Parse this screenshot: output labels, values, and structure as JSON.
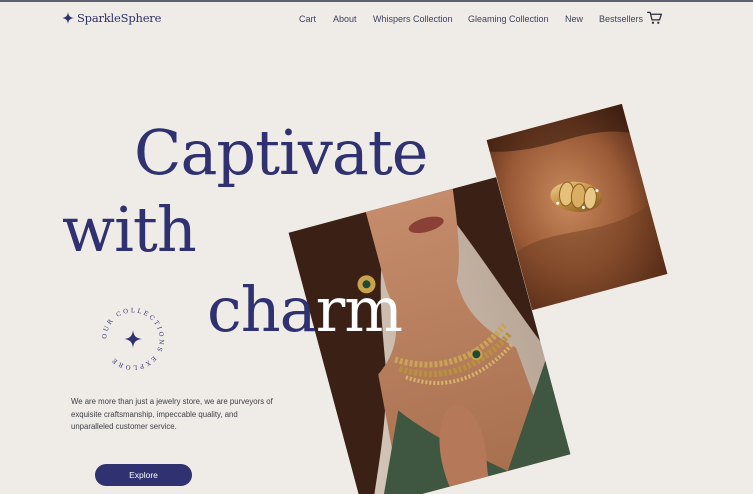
{
  "header": {
    "logo_text": "SparkleSphere",
    "nav": [
      {
        "label": "Cart"
      },
      {
        "label": "About"
      },
      {
        "label": "Whispers Collection"
      },
      {
        "label": "Gleaming Collection"
      },
      {
        "label": "New"
      },
      {
        "label": "Bestsellers"
      }
    ],
    "cart_icon": "shopping-cart-icon"
  },
  "hero": {
    "line1": "Captivate",
    "line2": "with",
    "line3_dark": "cha",
    "line3_light": "rm",
    "badge_text": "OUR COLLECTIONS EXPLORE",
    "badge_icon": "four-point-star-icon",
    "tagline": "We are more than just a jewelry store, we are purveyors of exquisite craftsmanship, impeccable quality, and unparalleled customer service.",
    "cta_label": "Explore"
  },
  "colors": {
    "background": "#efece8",
    "brand": "#2f3170",
    "text": "#3e3e44"
  }
}
